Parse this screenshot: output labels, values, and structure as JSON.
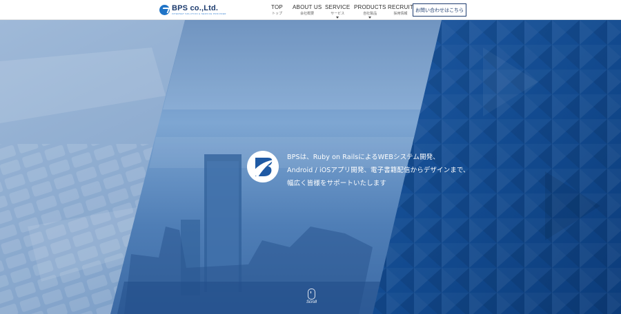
{
  "header": {
    "logo": {
      "main": "BPS co.,Ltd.",
      "sub": "INTERNET SOLUTION & SERVICE PROVIDER"
    },
    "nav": [
      {
        "en": "TOP",
        "ja": "トップ",
        "has_caret": false
      },
      {
        "en": "ABOUT US",
        "ja": "会社概要",
        "has_caret": false
      },
      {
        "en": "SERVICE",
        "ja": "サービス",
        "has_caret": true
      },
      {
        "en": "PRODUCTS",
        "ja": "自社製品",
        "has_caret": true
      },
      {
        "en": "RECRUIT",
        "ja": "採用情報",
        "has_caret": false
      }
    ],
    "contact_label": "お問い合わせはこちら"
  },
  "hero": {
    "tagline": [
      "BPSは、Ruby on RailsによるWEBシステム開発、",
      "Android / iOSアプリ開発、電子書籍配信からデザインまで、",
      "幅広く皆様をサポートいたします"
    ],
    "scroll_label": "Scroll"
  },
  "colors": {
    "brand_navy": "#1c3b6e",
    "brand_blue": "#1f74c7",
    "hero_dark": "#0d3f7c",
    "hero_light": "#7fa8d6"
  },
  "icons": {
    "logo": "bps-logo-icon",
    "scroll": "mouse-scroll-icon",
    "caret": "caret-down-icon"
  }
}
